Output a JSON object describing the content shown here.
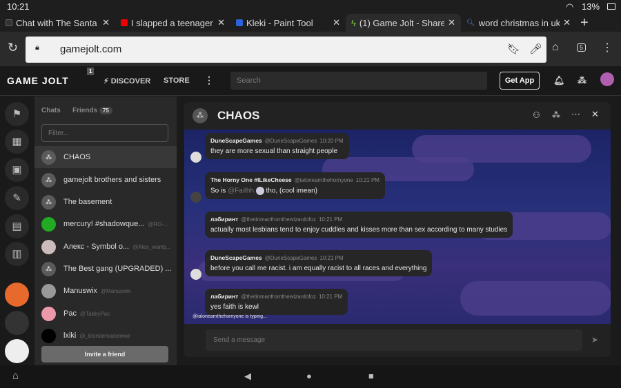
{
  "status": {
    "time": "10:21",
    "battery": "13%"
  },
  "tabs": [
    {
      "title": "Chat with The Santa Cl",
      "color": "#333"
    },
    {
      "title": "I slapped a teenager at",
      "color": "#e00"
    },
    {
      "title": "Kleki - Paint Tool",
      "color": "#2b63d9"
    },
    {
      "title": "(1) Game Jolt - Share y",
      "color": "#7fd43a",
      "active": true
    },
    {
      "title": "word christmas in ukra",
      "color": "#4a90e2"
    }
  ],
  "browser": {
    "url": "gamejolt.com",
    "tab_count": "5"
  },
  "header": {
    "logo": "GAME JOLT",
    "badge": "1",
    "discover": "DISCOVER",
    "store": "STORE",
    "search_placeholder": "Search",
    "get_app": "Get App"
  },
  "chatlist": {
    "tab_chats": "Chats",
    "tab_friends": "Friends",
    "friends_count": "75",
    "filter_placeholder": "Filter...",
    "invite": "Invite a friend",
    "items": [
      {
        "name": "CHAOS",
        "handle": ""
      },
      {
        "name": "gamejolt brothers and sisters",
        "handle": ""
      },
      {
        "name": "The basement",
        "handle": ""
      },
      {
        "name": "mercury! #shadowque...",
        "handle": "@RO-..."
      },
      {
        "name": "Алекс - Symbol o...",
        "handle": "@Alex_wants..."
      },
      {
        "name": "The Best gang (UPGRADED) ...",
        "handle": ""
      },
      {
        "name": "Manuswix",
        "handle": "@Manuswix"
      },
      {
        "name": "Pac",
        "handle": "@TabbyPac"
      },
      {
        "name": "lxiki",
        "handle": "@_blondemadeleine"
      }
    ]
  },
  "chat": {
    "title": "CHAOS",
    "send_placeholder": "Send a message",
    "typing": "@ialoneamthehornyone is typing...",
    "messages": [
      {
        "user": "DuneScapeGames",
        "handle": "@DuneScapeGames",
        "time": "10:20 PM",
        "text": "they are more sexual than straight people"
      },
      {
        "user": "The Horny One #ILikeCheese",
        "handle": "@ialoneamthehornyone",
        "time": "10:21 PM",
        "text": "So is",
        "mention": "@Faithh",
        "text2": "tho, (cool imean)"
      },
      {
        "user": "лабиринт",
        "handle": "@thetinmanfromthewizardofoz",
        "time": "10:21 PM",
        "text": "actually most lesbians tend to enjoy cuddles and kisses more than sex according to many studies"
      },
      {
        "user": "DuneScapeGames",
        "handle": "@DuneScapeGames",
        "time": "10:21 PM",
        "text": "before you call me racist. i am equally racist to all races and everything"
      },
      {
        "user": "лабиринт",
        "handle": "@thetinmanfromthewizardofoz",
        "time": "10:21 PM",
        "text": "yes faith is kewl"
      }
    ]
  }
}
